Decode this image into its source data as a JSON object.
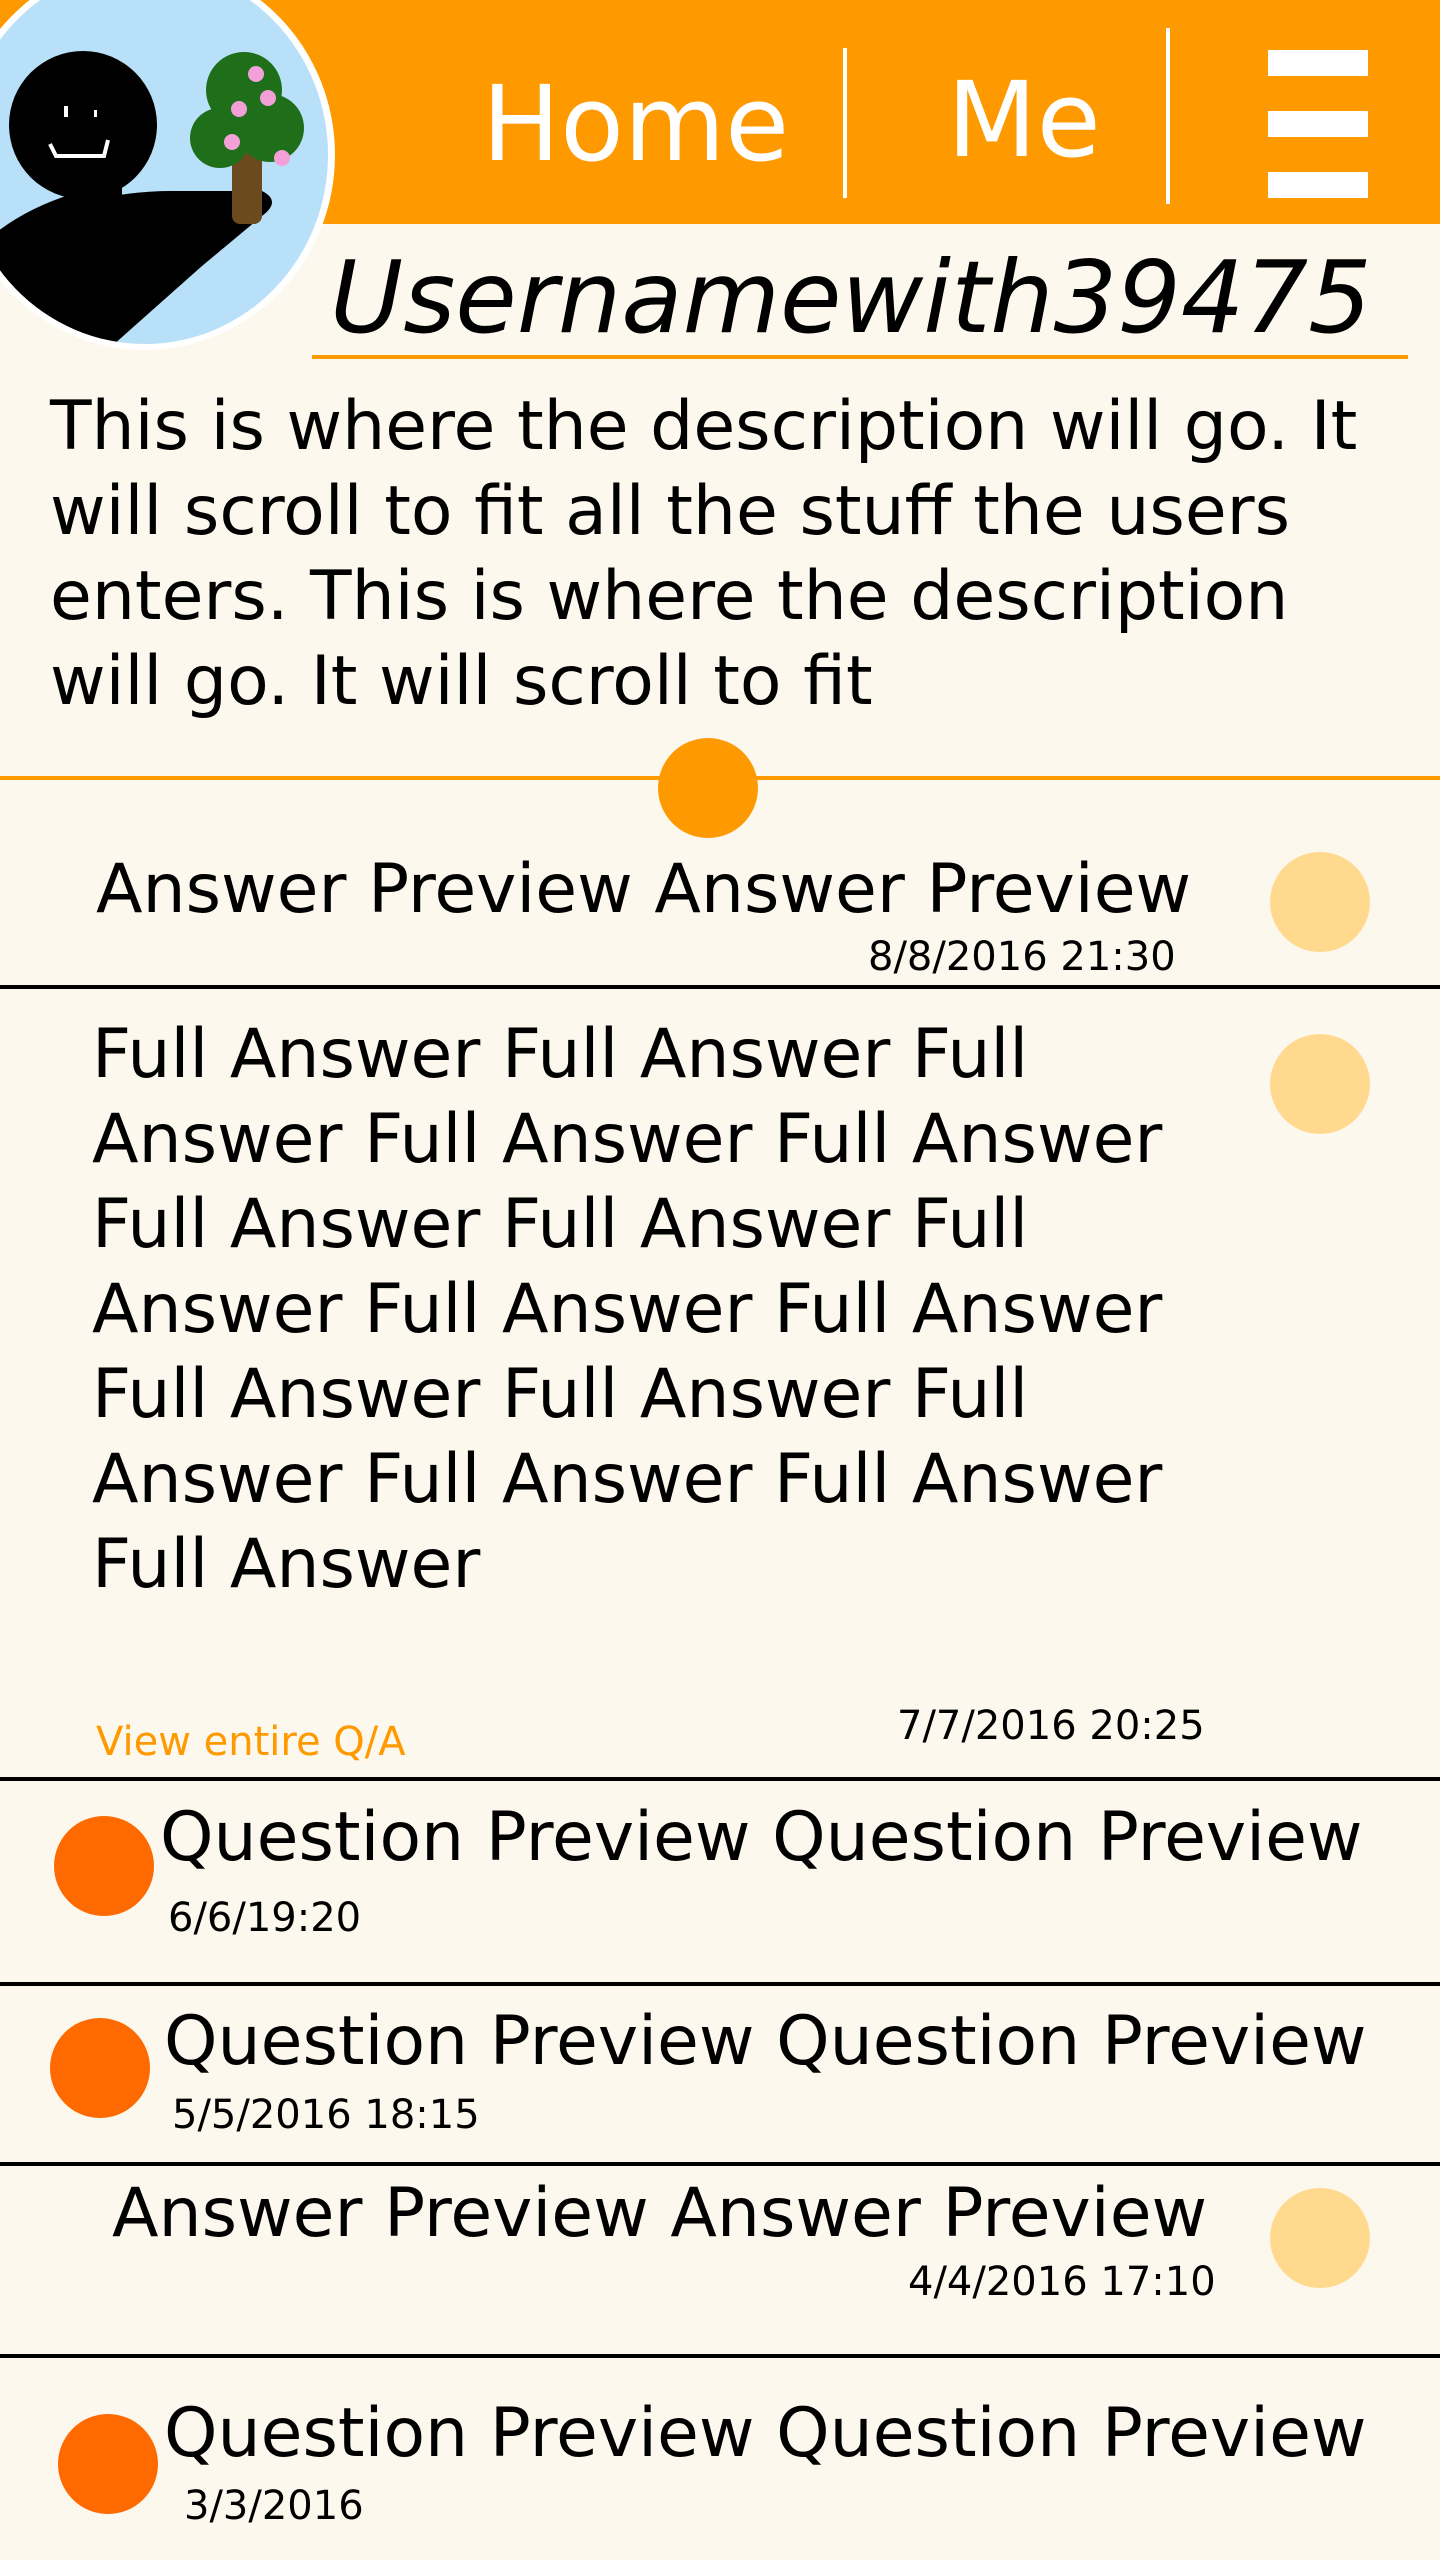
{
  "header": {
    "nav": {
      "home_label": "Home",
      "me_label": "Me"
    },
    "menu_icon": "hamburger-menu-icon",
    "colors": {
      "bar": "#ff9900",
      "text": "#ffffff"
    }
  },
  "profile": {
    "avatar_icon": "user-avatar-drawing",
    "username": "Usernamewith39475",
    "description": "This is where the description will go. It will scroll to fit all the stuff the users enters. This is where the description will go. It will scroll to fit"
  },
  "feed": [
    {
      "kind": "answer",
      "text": "Answer Preview Answer Preview",
      "timestamp": "8/8/2016 21:30"
    },
    {
      "kind": "answer-expanded",
      "text": "Full Answer Full Answer Full Answer Full Answer Full Answer Full Answer Full Answer Full Answer Full Answer Full Answer Full Answer Full Answer Full Answer Full Answer Full Answer Full Answer",
      "timestamp": "7/7/2016 20:25",
      "link_label": "View entire Q/A"
    },
    {
      "kind": "question",
      "text": "Question Preview Question Preview",
      "timestamp": "6/6/19:20"
    },
    {
      "kind": "question",
      "text": "Question Preview Question Preview",
      "timestamp": "5/5/2016 18:15"
    },
    {
      "kind": "answer",
      "text": "Answer Preview Answer Preview",
      "timestamp": "4/4/2016 17:10"
    },
    {
      "kind": "question",
      "text": "Question Preview Question Preview",
      "timestamp": "3/3/2016"
    }
  ],
  "colors": {
    "background": "#fdf8ee",
    "accent": "#ff9900",
    "answer_dot": "#ffd98e",
    "question_dot": "#ff6a00"
  }
}
